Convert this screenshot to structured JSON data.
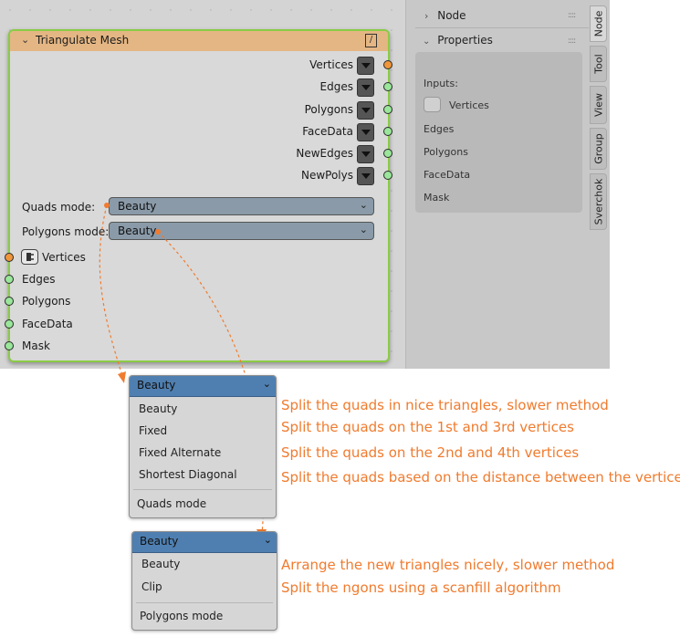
{
  "node": {
    "title": "Triangulate Mesh",
    "outputs": [
      "Vertices",
      "Edges",
      "Polygons",
      "FaceData",
      "NewEdges",
      "NewPolys"
    ],
    "quads_mode_label": "Quads mode:",
    "quads_mode_value": "Beauty",
    "polygons_mode_label": "Polygons mode:",
    "polygons_mode_value": "Beauty",
    "inputs": [
      "Vertices",
      "Edges",
      "Polygons",
      "FaceData",
      "Mask"
    ]
  },
  "npanel": {
    "node_section": "Node",
    "properties_section": "Properties",
    "inputs_label": "Inputs:",
    "inputs": [
      "Vertices",
      "Edges",
      "Polygons",
      "FaceData",
      "Mask"
    ],
    "tabs": [
      "Node",
      "Tool",
      "View",
      "Group",
      "Sverchok"
    ]
  },
  "quads_menu": {
    "current": "Beauty",
    "items": [
      "Beauty",
      "Fixed",
      "Fixed Alternate",
      "Shortest Diagonal"
    ],
    "title": "Quads mode",
    "descriptions": [
      "Split the quads in nice triangles, slower method",
      "Split the quads on the 1st and 3rd vertices",
      "Split the quads on the 2nd and 4th vertices",
      "Split the quads based on the distance between the vertices"
    ]
  },
  "polygons_menu": {
    "current": "Beauty",
    "items": [
      "Beauty",
      "Clip"
    ],
    "title": "Polygons mode",
    "descriptions": [
      "Arrange the new triangles nicely, slower method",
      "Split the ngons using a scanfill algorithm"
    ]
  },
  "colors": {
    "node_header": "#e4b684",
    "node_border": "#8acb45",
    "annotation": "#f07b2e",
    "menu_header": "#4f7fb0"
  }
}
